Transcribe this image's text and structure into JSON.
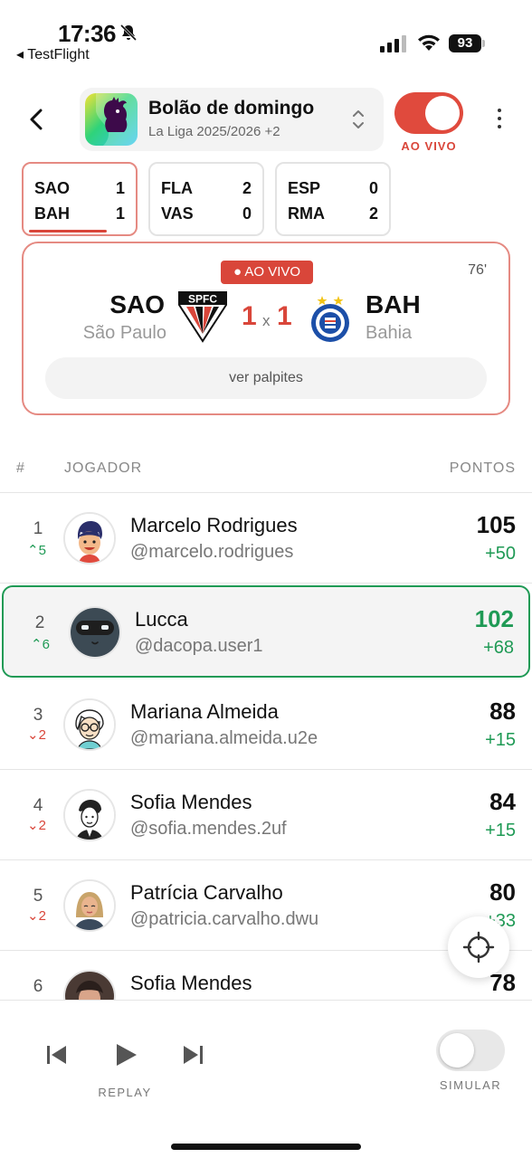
{
  "status_bar": {
    "time": "17:36",
    "back_app": "◂ TestFlight",
    "battery": "93"
  },
  "header": {
    "league_title": "Bolão de domingo",
    "league_subtitle": "La Liga 2025/2026 +2",
    "live_label": "AO VIVO",
    "live_toggle_on": true
  },
  "matches": [
    {
      "home": "SAO",
      "home_score": "1",
      "away": "BAH",
      "away_score": "1",
      "selected": true
    },
    {
      "home": "FLA",
      "home_score": "2",
      "away": "VAS",
      "away_score": "0",
      "selected": false
    },
    {
      "home": "ESP",
      "home_score": "0",
      "away": "RMA",
      "away_score": "2",
      "selected": false
    }
  ],
  "match_card": {
    "live_badge": "● AO VIVO",
    "minute": "76'",
    "home_code": "SAO",
    "home_name": "São Paulo",
    "home_score": "1",
    "separator": "x",
    "away_score": "1",
    "away_code": "BAH",
    "away_name": "Bahia",
    "palpites_label": "ver palpites",
    "colors": {
      "live": "#d9463a"
    }
  },
  "ranking": {
    "headers": {
      "pos": "#",
      "player": "JOGADOR",
      "points": "PONTOS"
    },
    "rows": [
      {
        "pos": "1",
        "delta": "⌃5",
        "dir": "up",
        "name": "Marcelo Rodrigues",
        "handle": "@marcelo.rodrigues",
        "points": "105",
        "gain": "+50",
        "avatar": "boy-avatar-icon"
      },
      {
        "pos": "2",
        "delta": "⌃6",
        "dir": "up",
        "name": "Lucca",
        "handle": "@dacopa.user1",
        "points": "102",
        "gain": "+68",
        "avatar": "robot-avatar-icon",
        "is_me": true
      },
      {
        "pos": "3",
        "delta": "⌄2",
        "dir": "down",
        "name": "Mariana Almeida",
        "handle": "@mariana.almeida.u2e",
        "points": "88",
        "gain": "+15",
        "avatar": "glasses-avatar-icon"
      },
      {
        "pos": "4",
        "delta": "⌄2",
        "dir": "down",
        "name": "Sofia Mendes",
        "handle": "@sofia.mendes.2uf",
        "points": "84",
        "gain": "+15",
        "avatar": "sketch-avatar-icon"
      },
      {
        "pos": "5",
        "delta": "⌄2",
        "dir": "down",
        "name": "Patrícia Carvalho",
        "handle": "@patricia.carvalho.dwu",
        "points": "80",
        "gain": "+33",
        "avatar": "woman-avatar-icon"
      },
      {
        "pos": "6",
        "delta": "",
        "dir": "",
        "name": "Sofia Mendes",
        "handle": "",
        "points": "78",
        "gain": "",
        "avatar": "photo-avatar-icon"
      }
    ]
  },
  "bottom": {
    "replay_label": "REPLAY",
    "simular_label": "SIMULAR",
    "simular_on": false
  },
  "colors": {
    "accent_red": "#d9463a",
    "accent_green": "#1f9a55"
  }
}
